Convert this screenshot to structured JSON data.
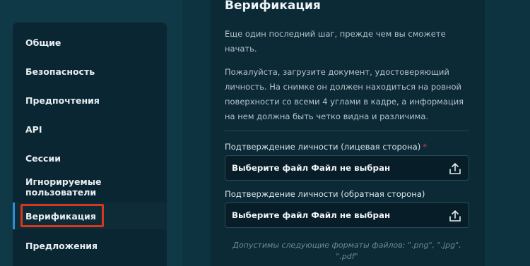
{
  "sidebar": {
    "items": [
      {
        "label": "Общие"
      },
      {
        "label": "Безопасность"
      },
      {
        "label": "Предпочтения"
      },
      {
        "label": "API"
      },
      {
        "label": "Сессии"
      },
      {
        "label": "Игнорируемые пользователи"
      },
      {
        "label": "Верификация",
        "active": true
      },
      {
        "label": "Предложения"
      }
    ]
  },
  "verification": {
    "title": "Верификация",
    "intro": "Еще один последний шаг, прежде чем вы сможете начать.",
    "instructions": "Пожалуйста, загрузите документ, удостоверяющий личность. На снимке он должен находиться на ровной поверхности со всеми 4 углами в кадре, а информация на нем должна быть четко видна и различима.",
    "front_label": "Подтверждение личности (лицевая сторона)",
    "front_required_mark": "*",
    "front_file_text": "Выберите файл Файл не выбран",
    "back_label": "Подтверждение личности (обратная сторона)",
    "back_file_text": "Выберите файл Файл не выбран",
    "formats_hint": "Допустимы следующие форматы файлов: \".png\", \".jpg\", \".pdf\""
  },
  "colors": {
    "accent_bar": "#2f8fd6",
    "highlight_border": "#d9361e",
    "required": "#e6394a"
  },
  "icons": {
    "file_input": "upload-icon"
  }
}
